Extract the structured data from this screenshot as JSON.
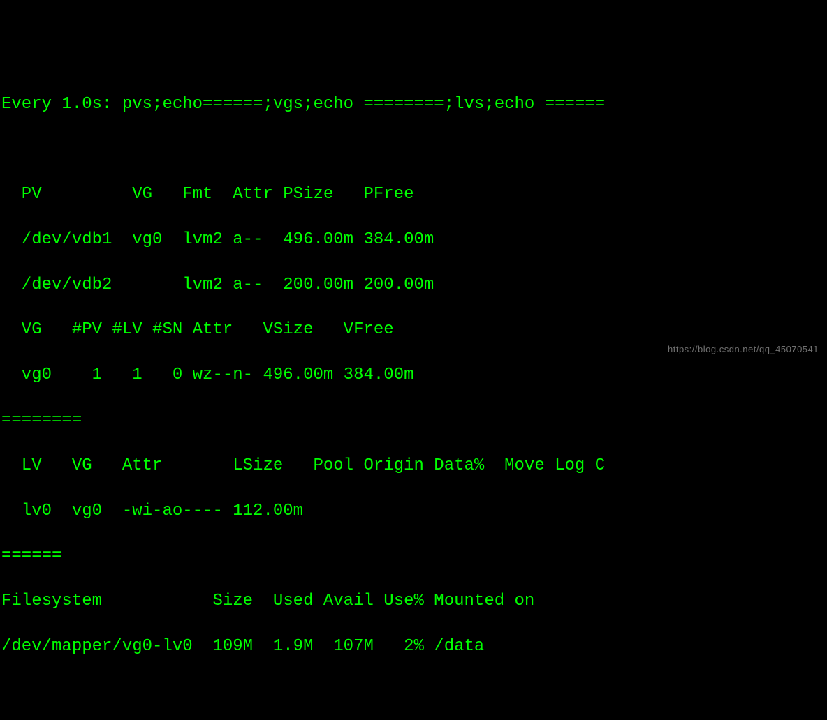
{
  "watch": {
    "header": "Every 1.0s: pvs;echo======;vgs;echo ========;lvs;echo ======"
  },
  "pvs": {
    "header": "  PV         VG   Fmt  Attr PSize   PFree  ",
    "rows": [
      "  /dev/vdb1  vg0  lvm2 a--  496.00m 384.00m",
      "  /dev/vdb2       lvm2 a--  200.00m 200.00m"
    ]
  },
  "vgs": {
    "header": "  VG   #PV #LV #SN Attr   VSize   VFree  ",
    "rows": [
      "  vg0    1   1   0 wz--n- 496.00m 384.00m"
    ]
  },
  "sep1": "========",
  "lvs": {
    "header": "  LV   VG   Attr       LSize   Pool Origin Data%  Move Log C",
    "rows": [
      "  lv0  vg0  -wi-ao---- 112.00m"
    ]
  },
  "sep2": "======",
  "df": {
    "header": "Filesystem           Size  Used Avail Use% Mounted on",
    "rows": [
      "/dev/mapper/vg0-lv0  109M  1.9M  107M   2% /data"
    ]
  },
  "watermark": "https://blog.csdn.net/qq_45070541"
}
